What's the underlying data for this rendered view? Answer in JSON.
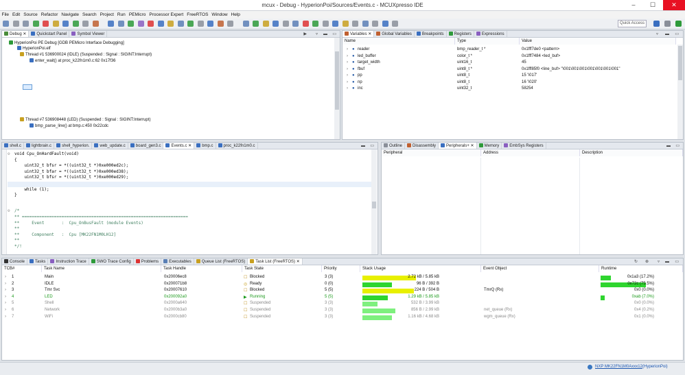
{
  "window": {
    "title": "mcux - Debug - HyperionPoi/Sources/Events.c - MCUXpresso IDE",
    "min": "–",
    "max": "☐",
    "close": "✕"
  },
  "menu": [
    "File",
    "Edit",
    "Source",
    "Refactor",
    "Navigate",
    "Search",
    "Project",
    "Run",
    "PEMicro",
    "Processor Expert",
    "FreeRTOS",
    "Window",
    "Help"
  ],
  "quick_access": "Quick Access",
  "debug": {
    "tabs": [
      "Debug",
      "Quickstart Panel",
      "Symbol Viewer"
    ],
    "tree": [
      "HyperionPoi PE Debug [GDB PEMicro Interface Debugging]",
      "HyperionPoi.elf",
      "Thread #1 536900024 (IDLE) (Suspended : Signal : SIGINT:Interrupt)",
      "enter_wait() at proc_k22fn1m0.c:62 0x17f36",
      "Thread #7 536908448 (LED) (Suspended : Signal : SIGINT:Interrupt)",
      "bmp_parse_line() at bmp.c:450 0x22cdc"
    ]
  },
  "variables": {
    "tabs": [
      "Variables",
      "Global Variables",
      "Breakpoints",
      "Registers",
      "Expressions"
    ],
    "headers": [
      "Name",
      "Type",
      "Value"
    ],
    "rows": [
      [
        "reader",
        "bmp_reader_t *",
        "0x1fff7de0 <pattern>"
      ],
      [
        "led_buffer",
        "color_t *",
        "0x1fff7484 <led_buf>"
      ],
      [
        "target_width",
        "uint16_t",
        "45"
      ],
      [
        "fbuf",
        "uint8_t *",
        "0x1fff85f0 <line_buf> \"\\001\\001\\001\\001\\001\\001\\001\""
      ],
      [
        "pp",
        "uint8_t",
        "15 '\\017'"
      ],
      [
        "np",
        "uint8_t",
        "16 '\\020'"
      ],
      [
        "inc",
        "uint32_t",
        "58254"
      ]
    ]
  },
  "editor": {
    "tabs": [
      "shell.c",
      "lightbrain.c",
      "shell_hyperion.",
      "web_update.c",
      "board_gen3.c",
      "Events.c",
      "bmp.c",
      "proc_k22fn1m0.c"
    ],
    "lines": [
      "void Cpu_OnHardFault(void)",
      "{",
      "    uint32_t bfsr = *((uint32_t *)0xe000ed2c);",
      "    uint32_t bfar = *((uint32_t *)0xe000ed38);",
      "    uint32_t bfsr = *((uint32_t *)0xe000ed29);",
      "",
      "    while (1);",
      "}",
      "",
      "/*",
      "** ===================================================================",
      "**     Event       :  Cpu_OnBusFault (module Events)",
      "**",
      "**     Component   :  Cpu [MK22FN1M0LH12]",
      "**",
      "*/!"
    ]
  },
  "outline": {
    "tabs": [
      "Outline",
      "Disassembly",
      "Peripherals+",
      "Memory",
      "EmbSys Registers"
    ],
    "headers": [
      "Peripheral",
      "Address",
      "Description"
    ]
  },
  "bottom": {
    "tabs": [
      "Console",
      "Tasks",
      "Instruction Trace",
      "SWO Trace Config",
      "Problems",
      "Executables",
      "Queue List (FreeRTOS)",
      "Task List (FreeRTOS)"
    ],
    "headers": [
      "TCB#",
      "Task Name",
      "Task Handle",
      "Task State",
      "Priority",
      "Stack Usage",
      "Event Object",
      "Runtime"
    ],
    "rows": [
      {
        "tcb": "1",
        "name": "Main",
        "handle": "0x20006ec8",
        "state": "Blocked",
        "prio": "3 (3)",
        "stack": "2.72 kB / 5.85 kB",
        "frac": 0.46,
        "event": "",
        "runtime": "0x1a3 (17.2%)",
        "rt": 0.172,
        "style": "normal"
      },
      {
        "tcb": "2",
        "name": "IDLE",
        "handle": "0x200071b8",
        "state": "Ready",
        "prio": "0 (0)",
        "stack": "96 B / 392 B",
        "frac": 0.25,
        "event": "",
        "runtime": "0x72c (75.5%)",
        "rt": 0.755,
        "style": "normal"
      },
      {
        "tcb": "3",
        "name": "Tmr Svc",
        "handle": "0x20007610",
        "state": "Blocked",
        "prio": "5 (5)",
        "stack": "224 B / 504 B",
        "frac": 0.44,
        "event": "TmrQ (Rx)",
        "runtime": "0x0 (0.0%)",
        "rt": 0,
        "style": "normal"
      },
      {
        "tcb": "4",
        "name": "LED",
        "handle": "0x200092a0",
        "state": "Running",
        "prio": "5 (5)",
        "stack": "1.29 kB / 5.85 kB",
        "frac": 0.22,
        "event": "",
        "runtime": "0xab (7.0%)",
        "rt": 0.07,
        "style": "running"
      },
      {
        "tcb": "5",
        "name": "Shell",
        "handle": "0x2000a640",
        "state": "Suspended",
        "prio": "3 (3)",
        "stack": "532 B / 3.99 kB",
        "frac": 0.13,
        "event": "",
        "runtime": "0x0 (0.0%)",
        "rt": 0,
        "style": "gray"
      },
      {
        "tcb": "6",
        "name": "Network",
        "handle": "0x2000b3a0",
        "state": "Suspended",
        "prio": "3 (3)",
        "stack": "856 B / 2.99 kB",
        "frac": 0.28,
        "event": "net_queue (Rx)",
        "runtime": "0x4 (0.2%)",
        "rt": 0,
        "style": "gray"
      },
      {
        "tcb": "7",
        "name": "WiFi",
        "handle": "0x2000cb80",
        "state": "Suspended",
        "prio": "3 (3)",
        "stack": "1.16 kB / 4.68 kB",
        "frac": 0.25,
        "event": "wgm_queue (Rx)",
        "runtime": "0x1 (0.0%)",
        "rt": 0,
        "style": "gray"
      }
    ]
  },
  "status": {
    "link_text": "NXP MK22FN1M0Axxx12",
    "project": "(HyperionPoi)"
  },
  "colors": {
    "yellow": "#e8f000",
    "green": "#2fd52f",
    "lightgreen": "#7ef07e"
  }
}
